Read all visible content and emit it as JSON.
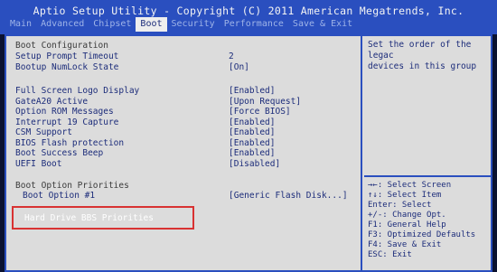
{
  "header": {
    "title": "Aptio Setup Utility - Copyright (C) 2011 American Megatrends, Inc.",
    "tabs": [
      "Main",
      "Advanced",
      "Chipset",
      "Boot",
      "Security",
      "Performance",
      "Save & Exit"
    ],
    "active_tab": "Boot"
  },
  "boot": {
    "config_heading": "Boot Configuration",
    "setup_prompt_timeout": {
      "label": "Setup Prompt Timeout",
      "value": "2"
    },
    "bootup_numlock": {
      "label": "Bootup NumLock State",
      "value": "[On]"
    },
    "full_screen_logo": {
      "label": "Full Screen Logo Display",
      "value": "[Enabled]"
    },
    "gate_a20": {
      "label": "GateA20 Active",
      "value": "[Upon Request]"
    },
    "option_rom": {
      "label": "Option ROM Messages",
      "value": "[Force BIOS]"
    },
    "interrupt_19": {
      "label": "Interrupt 19 Capture",
      "value": "[Enabled]"
    },
    "csm_support": {
      "label": "CSM Support",
      "value": "[Enabled]"
    },
    "bios_flash": {
      "label": "BIOS Flash protection",
      "value": "[Enabled]"
    },
    "boot_success_beep": {
      "label": "Boot Success Beep",
      "value": "[Enabled]"
    },
    "uefi_boot": {
      "label": "UEFI Boot",
      "value": "[Disabled]"
    },
    "priorities_heading": "Boot Option Priorities",
    "boot_option_1": {
      "label": "Boot Option #1",
      "value": "[Generic Flash Disk...]"
    },
    "hdd_bbs": {
      "label": "Hard Drive BBS Priorities"
    }
  },
  "help": {
    "description": "Set the order of the legac\ndevices in this group",
    "keys": [
      "→←: Select Screen",
      "↑↓: Select Item",
      "Enter: Select",
      "+/-: Change Opt.",
      "F1: General Help",
      "F3: Optimized Defaults",
      "F4: Save & Exit",
      "ESC: Exit"
    ]
  }
}
